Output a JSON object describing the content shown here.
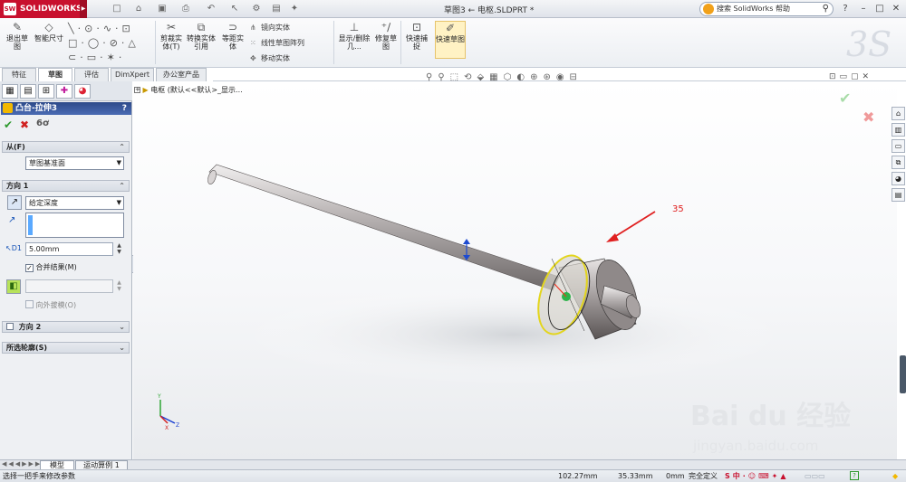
{
  "app": {
    "logo": "SOLIDWORKS",
    "doc_title": "草图3 ← 电枢.SLDPRT *"
  },
  "search": {
    "placeholder": "搜索 SolidWorks 帮助"
  },
  "ribbon": {
    "exit_sketch": "退出草图",
    "smart_dim": "智能尺寸",
    "trim": "剪裁实体(T)",
    "convert": "转换实体引用",
    "offset": "等距实体",
    "mirror": "镜向实体",
    "linear_pattern": "线性草图阵列",
    "move": "移动实体",
    "show_relations": "显示/删除几...",
    "repair": "修复草图",
    "quick_snaps": "快速捕捉",
    "rapid_sketch": "快速草图"
  },
  "tabs": [
    "特征",
    "草图",
    "评估",
    "DimXpert",
    "办公室产品"
  ],
  "active_tab": "草图",
  "property_manager": {
    "title": "凸台-拉伸3",
    "help": "?",
    "from_label": "从(F)",
    "from_value": "草图基准面",
    "direction1_label": "方向 1",
    "end_condition": "给定深度",
    "depth": "5.00mm",
    "merge_result": "合并结果(M)",
    "draft_outward": "向外拔模(O)",
    "direction2_label": "方向 2",
    "selected_contours": "所选轮廓(S)"
  },
  "tree": {
    "label": "电枢 (默认<<默认>_显示..."
  },
  "annotation": {
    "label": "35",
    "color": "#e02020"
  },
  "axis_labels": {
    "x": "X",
    "y": "Y",
    "z": "Z"
  },
  "bottom_tabs": [
    "模型",
    "运动算例 1"
  ],
  "status": {
    "hint": "选择一把手来修改参数",
    "x": "102.27mm",
    "y": "35.33mm",
    "z": "0mm",
    "state": "完全定义"
  },
  "watermark": {
    "line1": "Bai du 经验",
    "line2": "jingyan.baidu.com"
  },
  "colors": {
    "accent": "#c8102e",
    "ok": "#2e9a2e",
    "cancel": "#d02020",
    "header": "#2d4a8a"
  }
}
